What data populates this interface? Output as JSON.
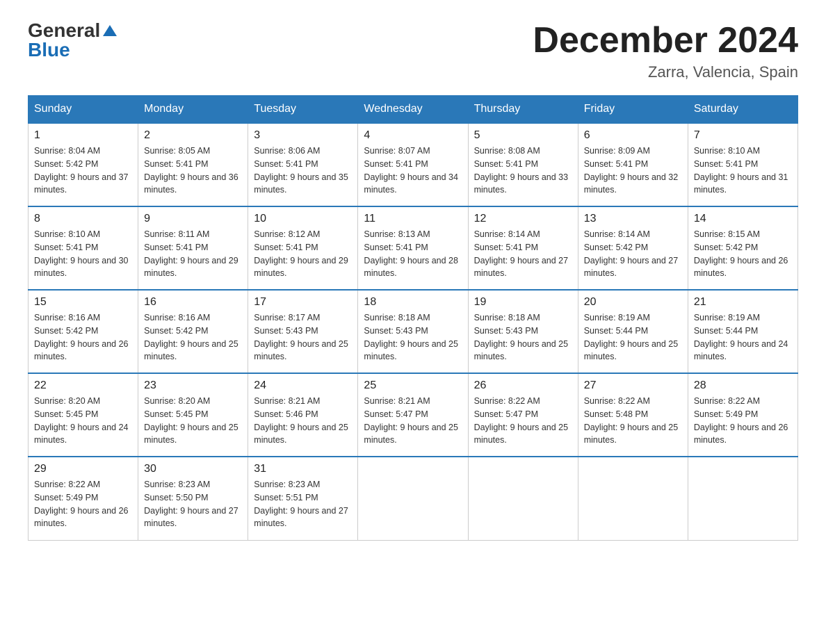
{
  "header": {
    "logo_general": "General",
    "logo_blue": "Blue",
    "month_title": "December 2024",
    "subtitle": "Zarra, Valencia, Spain"
  },
  "days_of_week": [
    "Sunday",
    "Monday",
    "Tuesday",
    "Wednesday",
    "Thursday",
    "Friday",
    "Saturday"
  ],
  "weeks": [
    [
      {
        "day": "1",
        "sunrise": "Sunrise: 8:04 AM",
        "sunset": "Sunset: 5:42 PM",
        "daylight": "Daylight: 9 hours and 37 minutes."
      },
      {
        "day": "2",
        "sunrise": "Sunrise: 8:05 AM",
        "sunset": "Sunset: 5:41 PM",
        "daylight": "Daylight: 9 hours and 36 minutes."
      },
      {
        "day": "3",
        "sunrise": "Sunrise: 8:06 AM",
        "sunset": "Sunset: 5:41 PM",
        "daylight": "Daylight: 9 hours and 35 minutes."
      },
      {
        "day": "4",
        "sunrise": "Sunrise: 8:07 AM",
        "sunset": "Sunset: 5:41 PM",
        "daylight": "Daylight: 9 hours and 34 minutes."
      },
      {
        "day": "5",
        "sunrise": "Sunrise: 8:08 AM",
        "sunset": "Sunset: 5:41 PM",
        "daylight": "Daylight: 9 hours and 33 minutes."
      },
      {
        "day": "6",
        "sunrise": "Sunrise: 8:09 AM",
        "sunset": "Sunset: 5:41 PM",
        "daylight": "Daylight: 9 hours and 32 minutes."
      },
      {
        "day": "7",
        "sunrise": "Sunrise: 8:10 AM",
        "sunset": "Sunset: 5:41 PM",
        "daylight": "Daylight: 9 hours and 31 minutes."
      }
    ],
    [
      {
        "day": "8",
        "sunrise": "Sunrise: 8:10 AM",
        "sunset": "Sunset: 5:41 PM",
        "daylight": "Daylight: 9 hours and 30 minutes."
      },
      {
        "day": "9",
        "sunrise": "Sunrise: 8:11 AM",
        "sunset": "Sunset: 5:41 PM",
        "daylight": "Daylight: 9 hours and 29 minutes."
      },
      {
        "day": "10",
        "sunrise": "Sunrise: 8:12 AM",
        "sunset": "Sunset: 5:41 PM",
        "daylight": "Daylight: 9 hours and 29 minutes."
      },
      {
        "day": "11",
        "sunrise": "Sunrise: 8:13 AM",
        "sunset": "Sunset: 5:41 PM",
        "daylight": "Daylight: 9 hours and 28 minutes."
      },
      {
        "day": "12",
        "sunrise": "Sunrise: 8:14 AM",
        "sunset": "Sunset: 5:41 PM",
        "daylight": "Daylight: 9 hours and 27 minutes."
      },
      {
        "day": "13",
        "sunrise": "Sunrise: 8:14 AM",
        "sunset": "Sunset: 5:42 PM",
        "daylight": "Daylight: 9 hours and 27 minutes."
      },
      {
        "day": "14",
        "sunrise": "Sunrise: 8:15 AM",
        "sunset": "Sunset: 5:42 PM",
        "daylight": "Daylight: 9 hours and 26 minutes."
      }
    ],
    [
      {
        "day": "15",
        "sunrise": "Sunrise: 8:16 AM",
        "sunset": "Sunset: 5:42 PM",
        "daylight": "Daylight: 9 hours and 26 minutes."
      },
      {
        "day": "16",
        "sunrise": "Sunrise: 8:16 AM",
        "sunset": "Sunset: 5:42 PM",
        "daylight": "Daylight: 9 hours and 25 minutes."
      },
      {
        "day": "17",
        "sunrise": "Sunrise: 8:17 AM",
        "sunset": "Sunset: 5:43 PM",
        "daylight": "Daylight: 9 hours and 25 minutes."
      },
      {
        "day": "18",
        "sunrise": "Sunrise: 8:18 AM",
        "sunset": "Sunset: 5:43 PM",
        "daylight": "Daylight: 9 hours and 25 minutes."
      },
      {
        "day": "19",
        "sunrise": "Sunrise: 8:18 AM",
        "sunset": "Sunset: 5:43 PM",
        "daylight": "Daylight: 9 hours and 25 minutes."
      },
      {
        "day": "20",
        "sunrise": "Sunrise: 8:19 AM",
        "sunset": "Sunset: 5:44 PM",
        "daylight": "Daylight: 9 hours and 25 minutes."
      },
      {
        "day": "21",
        "sunrise": "Sunrise: 8:19 AM",
        "sunset": "Sunset: 5:44 PM",
        "daylight": "Daylight: 9 hours and 24 minutes."
      }
    ],
    [
      {
        "day": "22",
        "sunrise": "Sunrise: 8:20 AM",
        "sunset": "Sunset: 5:45 PM",
        "daylight": "Daylight: 9 hours and 24 minutes."
      },
      {
        "day": "23",
        "sunrise": "Sunrise: 8:20 AM",
        "sunset": "Sunset: 5:45 PM",
        "daylight": "Daylight: 9 hours and 25 minutes."
      },
      {
        "day": "24",
        "sunrise": "Sunrise: 8:21 AM",
        "sunset": "Sunset: 5:46 PM",
        "daylight": "Daylight: 9 hours and 25 minutes."
      },
      {
        "day": "25",
        "sunrise": "Sunrise: 8:21 AM",
        "sunset": "Sunset: 5:47 PM",
        "daylight": "Daylight: 9 hours and 25 minutes."
      },
      {
        "day": "26",
        "sunrise": "Sunrise: 8:22 AM",
        "sunset": "Sunset: 5:47 PM",
        "daylight": "Daylight: 9 hours and 25 minutes."
      },
      {
        "day": "27",
        "sunrise": "Sunrise: 8:22 AM",
        "sunset": "Sunset: 5:48 PM",
        "daylight": "Daylight: 9 hours and 25 minutes."
      },
      {
        "day": "28",
        "sunrise": "Sunrise: 8:22 AM",
        "sunset": "Sunset: 5:49 PM",
        "daylight": "Daylight: 9 hours and 26 minutes."
      }
    ],
    [
      {
        "day": "29",
        "sunrise": "Sunrise: 8:22 AM",
        "sunset": "Sunset: 5:49 PM",
        "daylight": "Daylight: 9 hours and 26 minutes."
      },
      {
        "day": "30",
        "sunrise": "Sunrise: 8:23 AM",
        "sunset": "Sunset: 5:50 PM",
        "daylight": "Daylight: 9 hours and 27 minutes."
      },
      {
        "day": "31",
        "sunrise": "Sunrise: 8:23 AM",
        "sunset": "Sunset: 5:51 PM",
        "daylight": "Daylight: 9 hours and 27 minutes."
      },
      null,
      null,
      null,
      null
    ]
  ]
}
